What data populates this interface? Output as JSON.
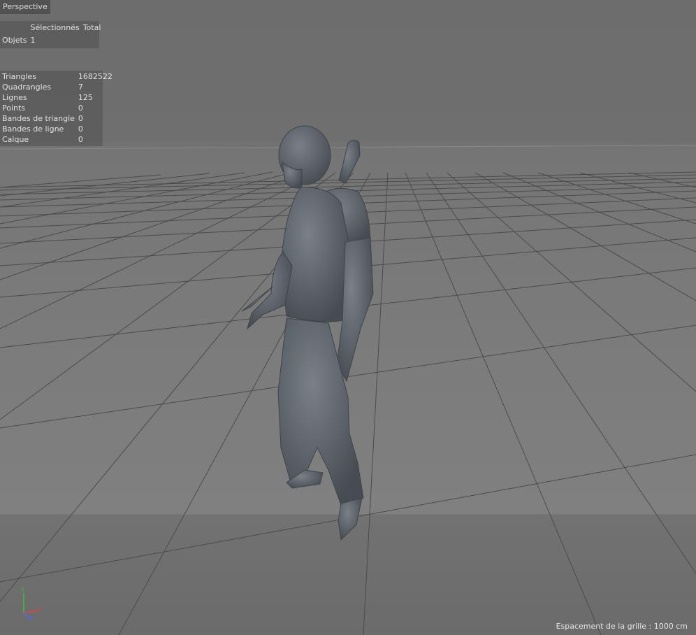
{
  "viewport": {
    "camera_label": "Perspective",
    "grid_spacing_text": "Espacement de la grille : 1000 cm"
  },
  "selection_info": {
    "headers": [
      "Sélectionnés",
      "Total"
    ],
    "rows": [
      {
        "label": "Objets",
        "selected": "1",
        "total": ""
      }
    ]
  },
  "scene_stats": [
    {
      "label": "Triangles",
      "value": "1682522"
    },
    {
      "label": "Quadrangles",
      "value": "7"
    },
    {
      "label": "Lignes",
      "value": "125"
    },
    {
      "label": "Points",
      "value": "0"
    },
    {
      "label": "Bandes de triangle",
      "value": "0"
    },
    {
      "label": "Bandes de ligne",
      "value": "0"
    },
    {
      "label": "Calque",
      "value": "0"
    }
  ],
  "axis_gizmo": {
    "y_label": "Y",
    "x_label": "X",
    "z_label": "Z",
    "colors": {
      "y": "#3fbf3f",
      "x": "#e04040",
      "z": "#4a6ff0"
    }
  },
  "colors": {
    "background": "#6e6e6e",
    "grid_line": "#4a4a4a",
    "model": "#5c6269"
  }
}
